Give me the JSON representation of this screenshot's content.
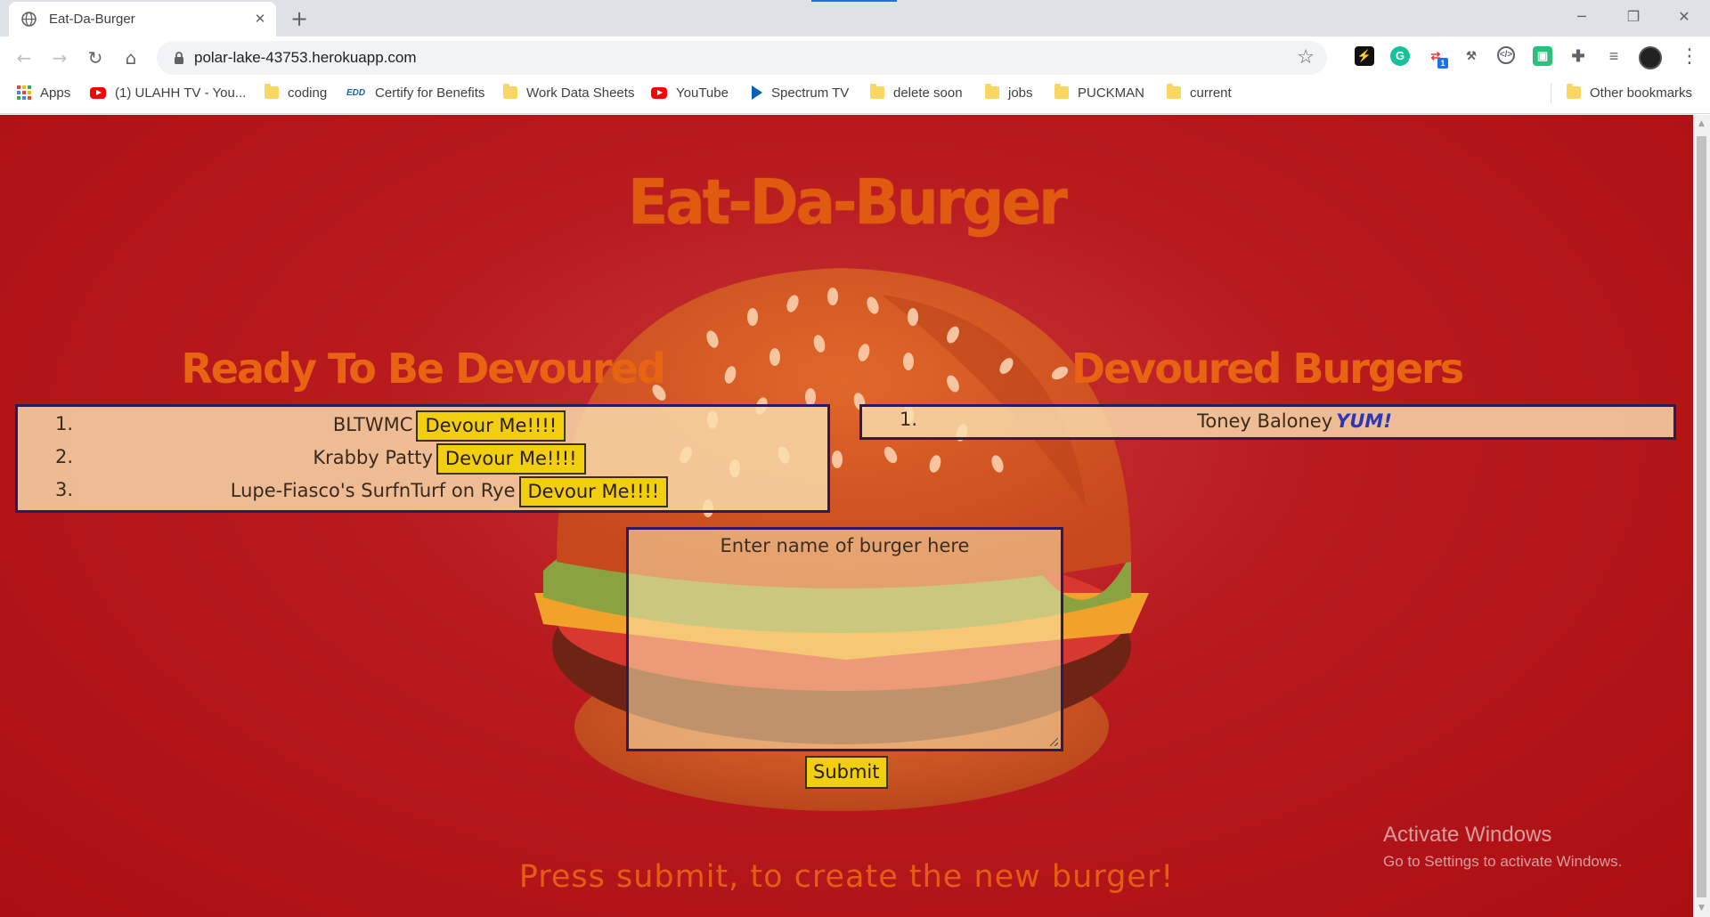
{
  "browser": {
    "tab_title": "Eat-Da-Burger",
    "url": "polar-lake-43753.herokuapp.com",
    "bookmarks": [
      {
        "label": "Apps",
        "icon": "apps-grid-icon"
      },
      {
        "label": "(1) ULAHH TV - You...",
        "icon": "youtube-icon"
      },
      {
        "label": "coding",
        "icon": "folder-icon"
      },
      {
        "label": "Certify for Benefits",
        "icon": "edd-icon",
        "icon_text": "EDD"
      },
      {
        "label": "Work Data Sheets",
        "icon": "folder-icon"
      },
      {
        "label": "YouTube",
        "icon": "youtube-icon"
      },
      {
        "label": "Spectrum TV",
        "icon": "spectrum-icon"
      },
      {
        "label": "delete soon",
        "icon": "folder-icon"
      },
      {
        "label": "jobs",
        "icon": "folder-icon"
      },
      {
        "label": "PUCKMAN",
        "icon": "folder-icon"
      },
      {
        "label": "current",
        "icon": "folder-icon"
      }
    ],
    "other_bookmarks": "Other bookmarks",
    "extension_badge": "1",
    "accent_color": "#1a73e8"
  },
  "page": {
    "title": "Eat-Da-Burger",
    "ready_heading": "Ready To Be Devoured",
    "devoured_heading": "Devoured Burgers",
    "ready_burgers": [
      {
        "num": "1.",
        "name": "BLTWMC",
        "button": "Devour Me!!!!"
      },
      {
        "num": "2.",
        "name": "Krabby Patty",
        "button": "Devour Me!!!!"
      },
      {
        "num": "3.",
        "name": "Lupe-Fiasco's SurfnTurf on Rye",
        "button": "Devour Me!!!!"
      }
    ],
    "devoured_burgers": [
      {
        "num": "1.",
        "name": "Toney Baloney",
        "tag": "YUM!"
      }
    ],
    "input_placeholder": "Enter name of burger here",
    "submit_label": "Submit",
    "footer_message": "Press submit, to create the new burger!",
    "background_color": "#b81a1e",
    "heading_color": "#e86412",
    "button_color": "#f2cf0e"
  },
  "os_overlay": {
    "activate_title": "Activate Windows",
    "activate_subtitle": "Go to Settings to activate Windows."
  }
}
